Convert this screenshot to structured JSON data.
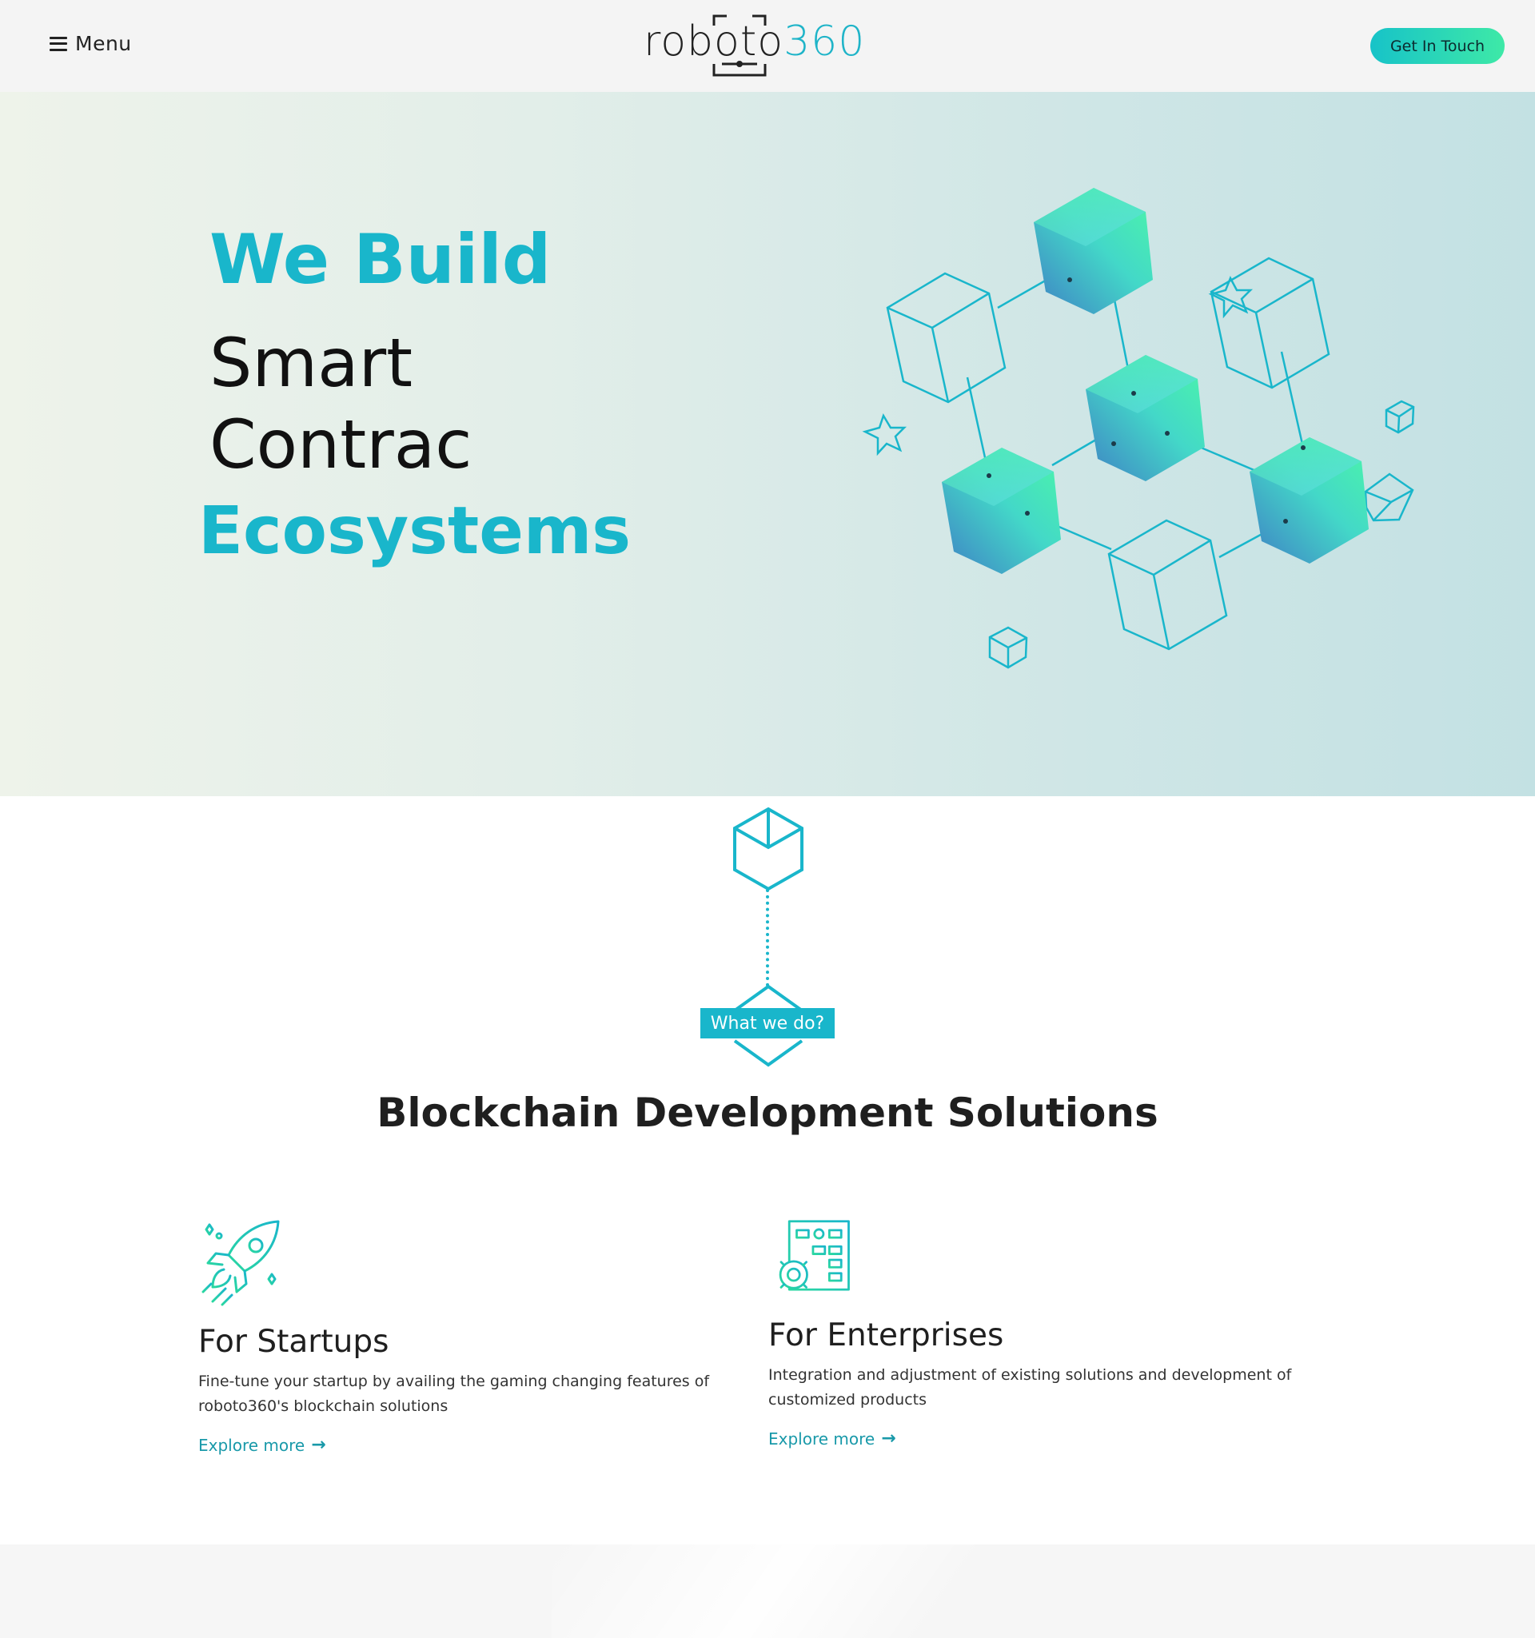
{
  "header": {
    "menu_label": "Menu",
    "logo_text_dark": "roboto",
    "logo_text_accent": "360",
    "cta_label": "Get In Touch"
  },
  "hero": {
    "line1": "We Build",
    "line2": "Smart",
    "line3": "Contrac",
    "line4": "Ecosystems"
  },
  "what_we_do": {
    "tag": "What we do?",
    "title": "Blockchain Development Solutions"
  },
  "cards": [
    {
      "icon": "rocket-icon",
      "title": "For Startups",
      "description": "Fine-tune your startup by availing the gaming changing features of roboto360's blockchain solutions",
      "link": "Explore more"
    },
    {
      "icon": "enterprise-flowchart-gear-icon",
      "title": "For Enterprises",
      "description": "Integration and adjustment of existing solutions and development of customized products",
      "link": "Explore more"
    }
  ],
  "colors": {
    "accent": "#19b6cb",
    "accent_green": "#3ee9a7",
    "link": "#1999a9",
    "header_bg": "#f4f4f4"
  }
}
